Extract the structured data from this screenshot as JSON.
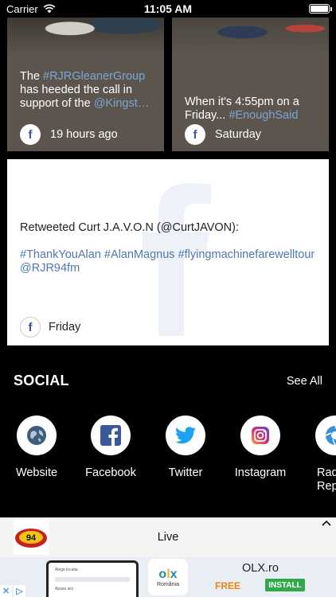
{
  "status_bar": {
    "carrier": "Carrier",
    "time": "11:05 AM"
  },
  "top_cards": [
    {
      "text_before": "The ",
      "highlight1": "#RJRGleanerGroup",
      "text_middle": " has heeded the call in support of the ",
      "highlight2": "@Kingst…",
      "footer": "19 hours ago",
      "source_icon": "facebook-icon"
    },
    {
      "text_before": "When it's 4:55pm on a Friday... ",
      "highlight1": "#EnoughSaid",
      "footer": "Saturday",
      "source_icon": "facebook-icon"
    }
  ],
  "tweet_card": {
    "line1": "Retweeted Curt J.A.V.O.N (@CurtJAVON):",
    "tags": "#ThankYouAlan #AlanMagnus #flyingmachinefarewelltour @RJR94fm",
    "footer": "Friday",
    "source_icon": "facebook-icon"
  },
  "social": {
    "title": "SOCIAL",
    "see_all": "See All",
    "items": [
      {
        "label": "Website",
        "icon": "globe-icon"
      },
      {
        "label": "Facebook",
        "icon": "facebook-icon"
      },
      {
        "label": "Twitter",
        "icon": "twitter-icon"
      },
      {
        "label": "Instagram",
        "icon": "instagram-icon"
      },
      {
        "label": "Rad Repo",
        "icon": "camera-aperture-icon"
      }
    ]
  },
  "player": {
    "label": "Live",
    "logo_text": "94"
  },
  "ad": {
    "title": "OLX.ro",
    "free": "FREE",
    "install": "INSTALL",
    "logo_sub": "România",
    "phone_rows": [
      "Alege locatia",
      "Apasa aici"
    ]
  },
  "colors": {
    "card_bg": "#5b554e",
    "link": "#7ea5d6",
    "facebook": "#3b5998",
    "twitter": "#1da1f2"
  }
}
